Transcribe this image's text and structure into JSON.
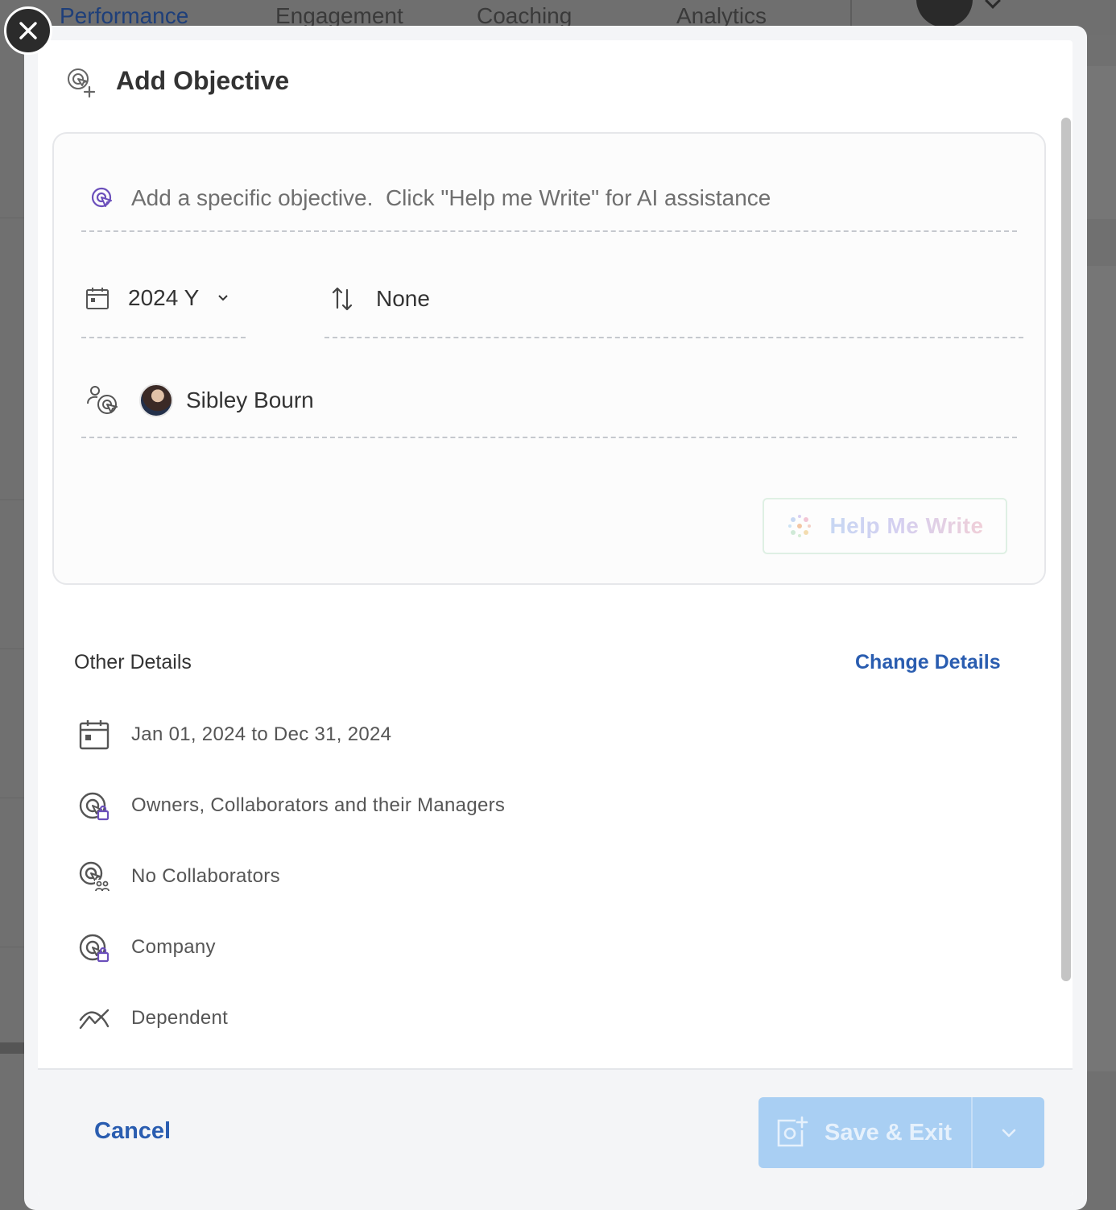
{
  "background_nav": {
    "items": [
      "Performance",
      "Engagement",
      "Coaching",
      "Analytics"
    ]
  },
  "modal": {
    "title": "Add Objective",
    "objective": {
      "placeholder": "Add a specific objective.  Click \"Help me Write\" for AI assistance",
      "value": ""
    },
    "period": {
      "label": "2024 Y"
    },
    "parent": {
      "label": "None"
    },
    "owner": {
      "name": "Sibley Bourn"
    },
    "help_me_write": {
      "label": "Help Me Write"
    },
    "other_details": {
      "title": "Other Details",
      "change_label": "Change Details",
      "rows": [
        {
          "icon": "calendar-icon",
          "text": "Jan 01, 2024 to Dec 31, 2024"
        },
        {
          "icon": "visibility-lock-icon",
          "text": "Owners, Collaborators and their Managers"
        },
        {
          "icon": "collaborators-icon",
          "text": "No Collaborators"
        },
        {
          "icon": "level-lock-icon",
          "text": "Company"
        },
        {
          "icon": "progress-trend-icon",
          "text": "Dependent"
        }
      ]
    },
    "footer": {
      "cancel_label": "Cancel",
      "save_label": "Save & Exit"
    }
  },
  "colors": {
    "accent": "#2a5db0",
    "save_disabled": "#a9cff3",
    "icon_purple": "#6b4fbb"
  }
}
